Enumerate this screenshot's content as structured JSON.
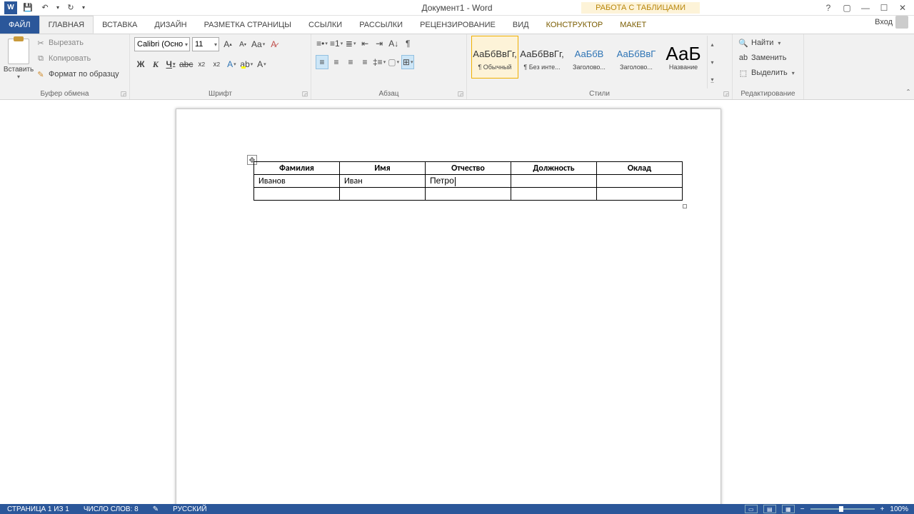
{
  "titlebar": {
    "doc_title": "Документ1 - Word",
    "table_tools": "РАБОТА С ТАБЛИЦАМИ"
  },
  "tabs": {
    "file": "ФАЙЛ",
    "home": "ГЛАВНАЯ",
    "insert": "ВСТАВКА",
    "design": "ДИЗАЙН",
    "layout": "РАЗМЕТКА СТРАНИЦЫ",
    "references": "ССЫЛКИ",
    "mailings": "РАССЫЛКИ",
    "review": "РЕЦЕНЗИРОВАНИЕ",
    "view": "ВИД",
    "table_design": "КОНСТРУКТОР",
    "table_layout": "МАКЕТ",
    "signin": "Вход"
  },
  "ribbon": {
    "clipboard": {
      "label": "Буфер обмена",
      "paste": "Вставить",
      "cut": "Вырезать",
      "copy": "Копировать",
      "format_painter": "Формат по образцу"
    },
    "font": {
      "label": "Шрифт",
      "name": "Calibri (Осно",
      "size": "11"
    },
    "paragraph": {
      "label": "Абзац"
    },
    "styles": {
      "label": "Стили",
      "items": [
        {
          "preview": "АаБбВвГг,",
          "name": "¶ Обычный",
          "cls": ""
        },
        {
          "preview": "АаБбВвГг,",
          "name": "¶ Без инте...",
          "cls": ""
        },
        {
          "preview": "АаБбВ",
          "name": "Заголово...",
          "cls": "blue"
        },
        {
          "preview": "АаБбВвГ",
          "name": "Заголово...",
          "cls": "blue"
        },
        {
          "preview": "АаБ",
          "name": "Название",
          "cls": "big"
        }
      ]
    },
    "editing": {
      "label": "Редактирование",
      "find": "Найти",
      "replace": "Заменить",
      "select": "Выделить"
    }
  },
  "table": {
    "headers": [
      "Фамилия",
      "Имя",
      "Отчество",
      "Должность",
      "Оклад"
    ],
    "rows": [
      [
        "Иванов",
        "Иван",
        "Петро",
        "",
        ""
      ],
      [
        "",
        "",
        "",
        "",
        ""
      ]
    ]
  },
  "statusbar": {
    "page": "СТРАНИЦА 1 ИЗ 1",
    "words": "ЧИСЛО СЛОВ: 8",
    "lang": "РУССКИЙ",
    "zoom": "100%"
  }
}
